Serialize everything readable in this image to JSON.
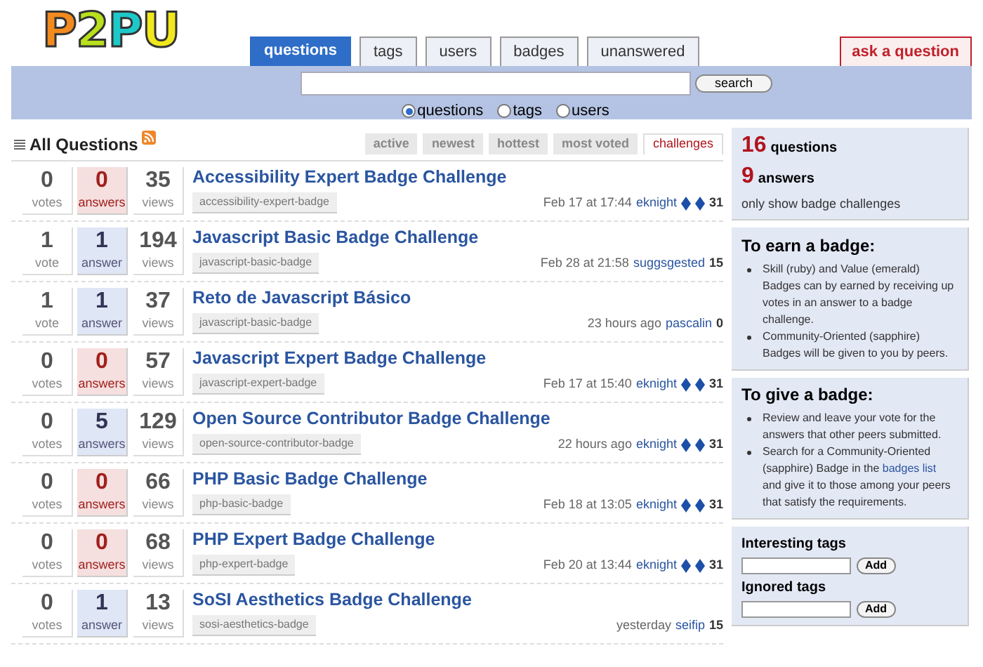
{
  "logo": {
    "text": "P2PU"
  },
  "nav_tabs": [
    {
      "label": "questions",
      "selected": true
    },
    {
      "label": "tags",
      "selected": false
    },
    {
      "label": "users",
      "selected": false
    },
    {
      "label": "badges",
      "selected": false
    },
    {
      "label": "unanswered",
      "selected": false
    }
  ],
  "ask_button": "ask a question",
  "search": {
    "button": "search",
    "scopes": [
      {
        "label": "questions",
        "selected": true
      },
      {
        "label": "tags",
        "selected": false
      },
      {
        "label": "users",
        "selected": false
      }
    ]
  },
  "list_title": "All Questions",
  "sort_tabs": [
    {
      "label": "active",
      "selected": false
    },
    {
      "label": "newest",
      "selected": false
    },
    {
      "label": "hottest",
      "selected": false
    },
    {
      "label": "most voted",
      "selected": false
    },
    {
      "label": "challenges",
      "selected": true
    }
  ],
  "questions": [
    {
      "votes": "0",
      "votes_label": "votes",
      "answers": "0",
      "answers_label": "answers",
      "answered": false,
      "views": "35",
      "views_label": "views",
      "title": "Accessibility Expert Badge Challenge",
      "tag": "accessibility-expert-badge",
      "time": "Feb 17 at 17:44",
      "user": "eknight",
      "badges": [
        {
          "color": "#1c4fa8"
        },
        {
          "color": "#1c4fa8"
        }
      ],
      "score": "31"
    },
    {
      "votes": "1",
      "votes_label": "vote",
      "answers": "1",
      "answers_label": "answer",
      "answered": true,
      "views": "194",
      "views_label": "views",
      "title": "Javascript Basic Badge Challenge",
      "tag": "javascript-basic-badge",
      "time": "Feb 28 at 21:58",
      "user": "suggsgested",
      "score": "15"
    },
    {
      "votes": "1",
      "votes_label": "vote",
      "answers": "1",
      "answers_label": "answer",
      "answered": true,
      "views": "37",
      "views_label": "views",
      "title": "Reto de Javascript Básico",
      "tag": "javascript-basic-badge",
      "time": "23 hours ago",
      "user": "pascalin",
      "score": "0"
    },
    {
      "votes": "0",
      "votes_label": "votes",
      "answers": "0",
      "answers_label": "answers",
      "answered": false,
      "views": "57",
      "views_label": "views",
      "title": "Javascript Expert Badge Challenge",
      "tag": "javascript-expert-badge",
      "time": "Feb 17 at 15:40",
      "user": "eknight",
      "badges": [
        {
          "color": "#1c4fa8"
        },
        {
          "color": "#1c4fa8"
        }
      ],
      "score": "31"
    },
    {
      "votes": "0",
      "votes_label": "votes",
      "answers": "5",
      "answers_label": "answers",
      "answered": true,
      "views": "129",
      "views_label": "views",
      "title": "Open Source Contributor Badge Challenge",
      "tag": "open-source-contributor-badge",
      "time": "22 hours ago",
      "user": "eknight",
      "badges": [
        {
          "color": "#1c4fa8"
        },
        {
          "color": "#1c4fa8"
        }
      ],
      "score": "31"
    },
    {
      "votes": "0",
      "votes_label": "votes",
      "answers": "0",
      "answers_label": "answers",
      "answered": false,
      "views": "66",
      "views_label": "views",
      "title": "PHP Basic Badge Challenge",
      "tag": "php-basic-badge",
      "time": "Feb 18 at 13:05",
      "user": "eknight",
      "badges": [
        {
          "color": "#1c4fa8"
        },
        {
          "color": "#1c4fa8"
        }
      ],
      "score": "31"
    },
    {
      "votes": "0",
      "votes_label": "votes",
      "answers": "0",
      "answers_label": "answers",
      "answered": false,
      "views": "68",
      "views_label": "views",
      "title": "PHP Expert Badge Challenge",
      "tag": "php-expert-badge",
      "time": "Feb 20 at 13:44",
      "user": "eknight",
      "badges": [
        {
          "color": "#1c4fa8"
        },
        {
          "color": "#1c4fa8"
        }
      ],
      "score": "31"
    },
    {
      "votes": "0",
      "votes_label": "votes",
      "answers": "1",
      "answers_label": "answer",
      "answered": true,
      "views": "13",
      "views_label": "views",
      "title": "SoSI Aesthetics Badge Challenge",
      "tag": "sosi-aesthetics-badge",
      "time": "yesterday",
      "user": "seifip",
      "score": "15"
    }
  ],
  "stats": {
    "questions_count": "16",
    "questions_label": "questions",
    "answers_count": "9",
    "answers_label": "answers",
    "filter_note": "only show badge challenges"
  },
  "earn_box": {
    "title": "To earn a badge:",
    "items": [
      "Skill (ruby) and Value (emerald) Badges can by earned by receiving up votes in an answer to a badge challenge.",
      "Community-Oriented (sapphire) Badges will be given to you by peers."
    ]
  },
  "give_box": {
    "title": "To give a badge:",
    "items": [
      {
        "text": "Review and leave your vote for the answers that other peers submitted."
      },
      {
        "before": "Search for a Community-Oriented (sapphire) Badge in the",
        "link": "badges list",
        "after": "and give it to those among your peers that satisfy the requirements."
      }
    ]
  },
  "tag_filters": [
    {
      "label": "Interesting tags",
      "button": "Add"
    },
    {
      "label": "Ignored tags",
      "button": "Add"
    }
  ]
}
